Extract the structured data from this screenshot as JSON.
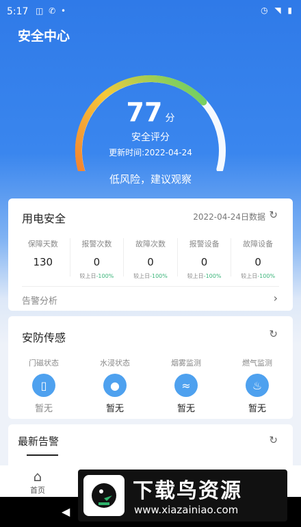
{
  "status_bar": {
    "time": "5:17",
    "left_icons": "◫ ✆ •",
    "right_icons": "◷ ◥ ▮"
  },
  "header": {
    "title": "安全中心"
  },
  "gauge": {
    "score": "77",
    "unit": "分",
    "label": "安全评分",
    "updated": "更新时间:2022-04-24",
    "risk_text": "低风险，建议观察",
    "score_fraction": 0.77,
    "colors": {
      "start": "#f26a2e",
      "mid": "#f5c93a",
      "end": "#5ad16a",
      "track": "#ffffff"
    }
  },
  "power_card": {
    "title": "用电安全",
    "date_note": "2022-04-24日数据",
    "stats": [
      {
        "label": "保障天数",
        "value": "130",
        "cmp_prefix": "",
        "cmp_pct": ""
      },
      {
        "label": "报警次数",
        "value": "0",
        "cmp_prefix": "较上日",
        "cmp_pct": "-100%"
      },
      {
        "label": "故障次数",
        "value": "0",
        "cmp_prefix": "较上日",
        "cmp_pct": "-100%"
      },
      {
        "label": "报警设备",
        "value": "0",
        "cmp_prefix": "较上日",
        "cmp_pct": "-100%"
      },
      {
        "label": "故障设备",
        "value": "0",
        "cmp_prefix": "较上日",
        "cmp_pct": "-100%"
      }
    ],
    "analysis": "告警分析"
  },
  "sensor_card": {
    "title": "安防传感",
    "sensors": [
      {
        "label": "门磁状态",
        "value": "暂无",
        "icon": "door-icon"
      },
      {
        "label": "水浸状态",
        "value": "暂无",
        "icon": "water-drop-icon"
      },
      {
        "label": "烟雾监测",
        "value": "暂无",
        "icon": "smoke-icon"
      },
      {
        "label": "燃气监测",
        "value": "暂无",
        "icon": "flame-icon"
      }
    ]
  },
  "alarm_card": {
    "title": "最新告警"
  },
  "tabbar": {
    "home_label": "首页"
  },
  "watermark": {
    "big": "下载鸟资源",
    "small": "www.xiazainiao.com"
  }
}
